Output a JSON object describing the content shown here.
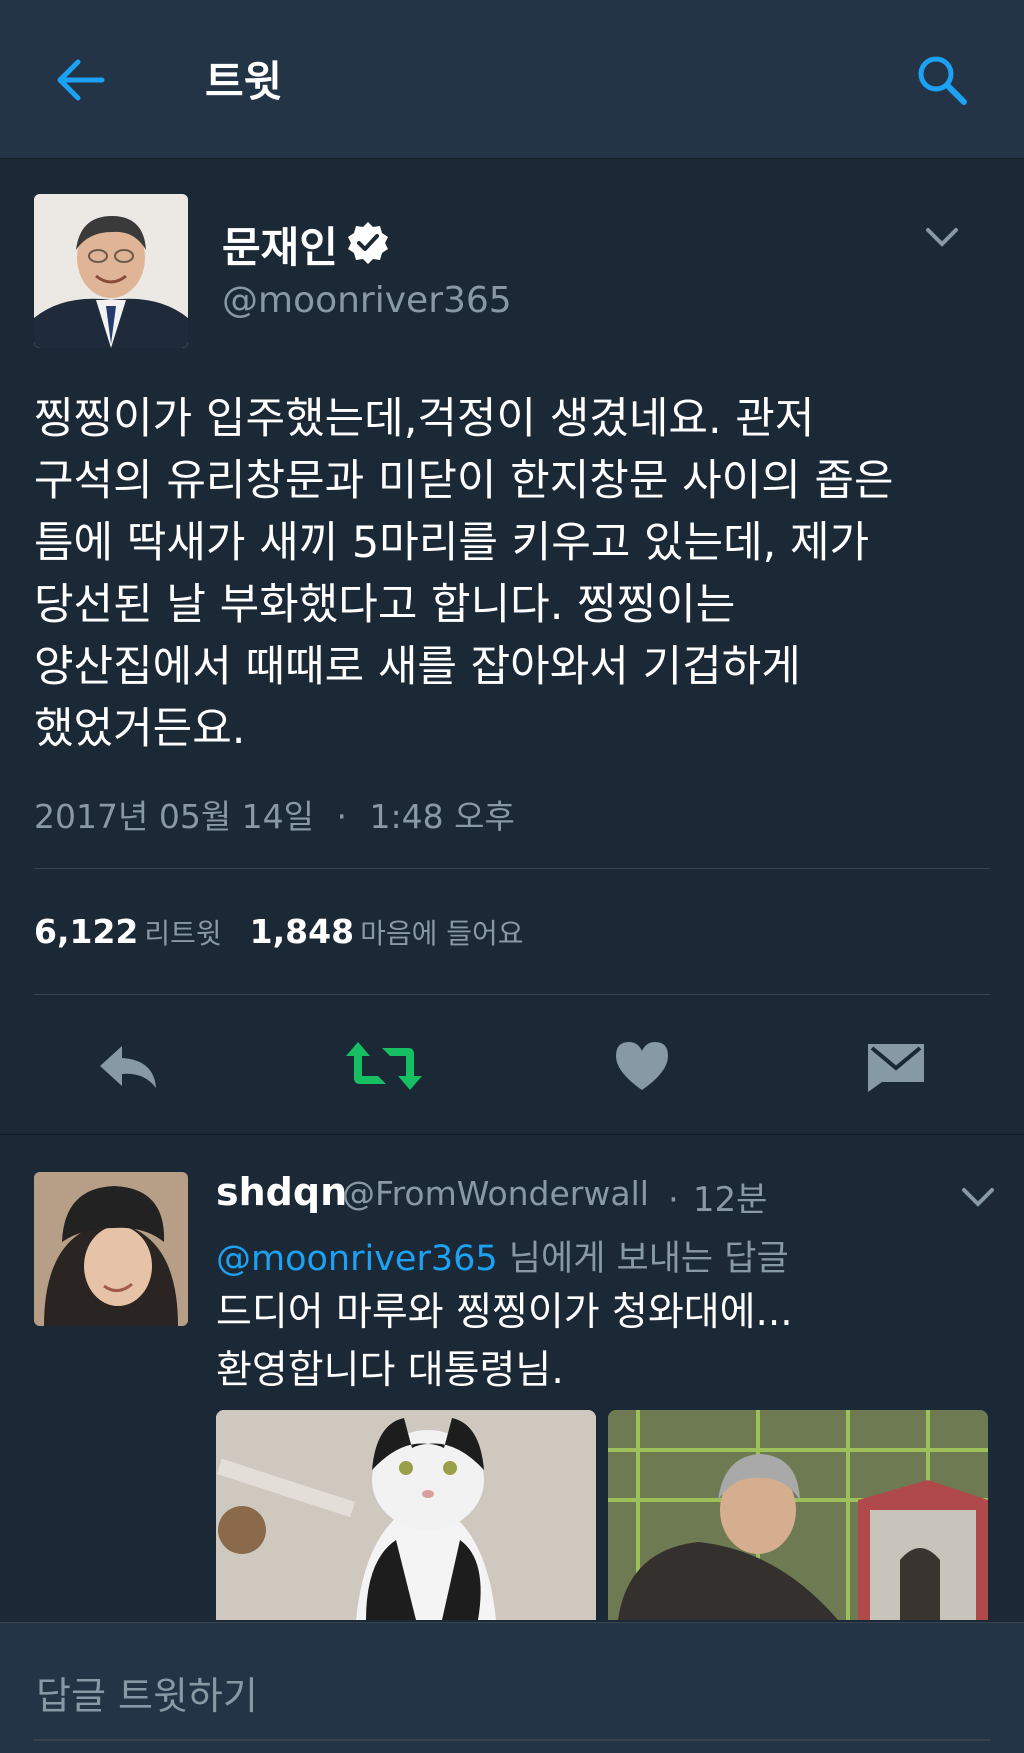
{
  "header": {
    "title": "트윗"
  },
  "tweet": {
    "author_name": "문재인",
    "author_handle": "@moonriver365",
    "text": "찡찡이가 입주했는데,걱정이 생겼네요. 관저\n구석의 유리창문과 미닫이 한지창문 사이의 좁은\n틈에 딱새가 새끼 5마리를 키우고 있는데, 제가\n당선된 날 부화했다고 합니다. 찡찡이는\n양산집에서 때때로 새를 잡아와서 기겁하게\n했었거든요.",
    "date": "2017년 05월 14일",
    "separator": "·",
    "time": "1:48 오후",
    "retweet_count": "6,122",
    "retweet_label": "리트윗",
    "like_count": "1,848",
    "like_label": "마음에 들어요"
  },
  "reply": {
    "name": "shdqn",
    "handle": "@FromWonderwall",
    "separator": "·",
    "time": "12분",
    "reply_to_mention": "@moonriver365",
    "reply_to_suffix": " 님에게 보내는 답글",
    "text": "드디어 마루와 찡찡이가 청와대에...\n환영합니다 대통령님."
  },
  "composer": {
    "placeholder": "답글 트윗하기"
  },
  "colors": {
    "background": "#1b2836",
    "bar": "#243447",
    "accent": "#1da1f2",
    "retweet_active": "#17bf63",
    "muted": "#8899a6",
    "icon": "#8899a6"
  }
}
